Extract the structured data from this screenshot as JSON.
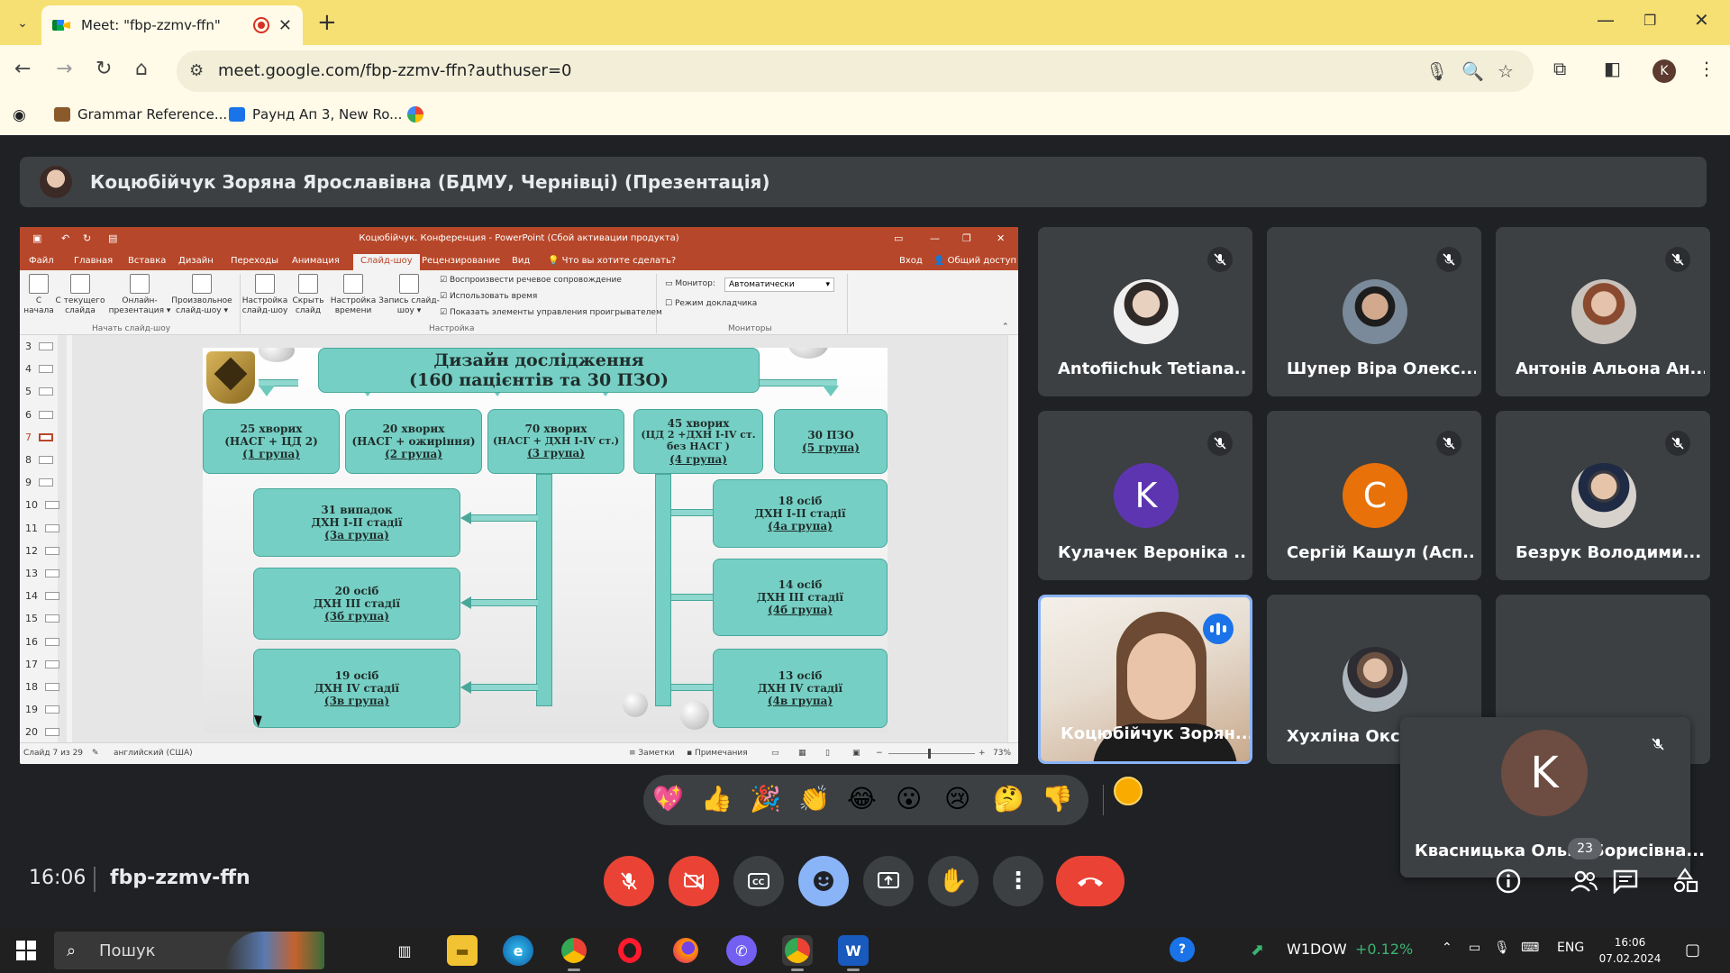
{
  "browser": {
    "tab_title": "Meet: \"fbp-zzmv-ffn\"",
    "new_tab": "+",
    "url": "meet.google.com/fbp-zzmv-ffn?authuser=0",
    "profile_initial": "K",
    "bookmarks": [
      {
        "label": "Grammar Reference...",
        "color": "#8b5a2b"
      },
      {
        "label": "Раунд Ап 3, New Ro...",
        "color": "#1a73e8"
      }
    ]
  },
  "meet": {
    "presenter_title": "Коцюбійчук Зоряна Ярославівна (БДМУ, Чернівці) (Презентація)",
    "time": "16:06",
    "meeting_code": "fbp-zzmv-ffn",
    "participants_count": "23",
    "participants": [
      {
        "name": "Antofiichuk Tetiana...",
        "type": "photo",
        "color": "#d9d2c8"
      },
      {
        "name": "Шупер Віра Олекс...",
        "type": "photo",
        "color": "#7a8a9a"
      },
      {
        "name": "Антонів Альона Ан...",
        "type": "photo",
        "color": "#b89a88"
      },
      {
        "name": "Кулачек Вероніка ...",
        "type": "letter",
        "letter": "K",
        "color": "#5e35b1"
      },
      {
        "name": "Сергій Кашул (Асп...",
        "type": "letter",
        "letter": "C",
        "color": "#e8710a"
      },
      {
        "name": "Безрук Володими...",
        "type": "photo",
        "color": "#c9c2bc"
      },
      {
        "name": "Коцюбійчук Зорян...",
        "type": "video"
      },
      {
        "name": "Хухліна Окса...",
        "type": "photo",
        "color": "#9aa4ad"
      }
    ],
    "floating_participant": {
      "name": "Квасницька Ольга Борисівна...",
      "letter": "K",
      "color": "#6d4c41"
    },
    "reactions": [
      "💖",
      "👍",
      "🎉",
      "👏",
      "😂",
      "😮",
      "😢",
      "🤔",
      "👎"
    ]
  },
  "powerpoint": {
    "window_title": "Коцюбійчук. Конференция - PowerPoint (Сбой активации продукта)",
    "menu": [
      "Файл",
      "Главная",
      "Вставка",
      "Дизайн",
      "Переходы",
      "Анимация",
      "Слайд-шоу",
      "Рецензирование",
      "Вид"
    ],
    "active_menu_index": 6,
    "tell_me": "Что вы хотите сделать?",
    "signin": "Вход",
    "share": "Общий доступ",
    "ribbon": {
      "btn_from_start": "С\nначала",
      "btn_from_current": "С текущего\nслайда",
      "btn_online": "Онлайн-\nпрезентация ▾",
      "btn_custom": "Произвольное\nслайд-шоу ▾",
      "btn_setup": "Настройка\nслайд-шоу",
      "btn_hide": "Скрыть\nслайд",
      "btn_rehearse": "Настройка\nвремени",
      "btn_record": "Запись слайд-\nшоу ▾",
      "check_narration": "Воспроизвести речевое сопровождение",
      "check_timings": "Использовать время",
      "check_controls": "Показать элементы управления проигрывателем",
      "monitor_label": "Монитор:",
      "monitor_value": "Автоматически",
      "presenter_view": "Режим докладчика",
      "group_start": "Начать слайд-шоу",
      "group_setup": "Настройка",
      "group_monitors": "Мониторы"
    },
    "thumb_numbers": [
      "3",
      "4",
      "5",
      "6",
      "7",
      "8",
      "9",
      "10",
      "11",
      "12",
      "13",
      "14",
      "15",
      "16",
      "17",
      "18",
      "19",
      "20"
    ],
    "current_slide_number": "7",
    "status_slide": "Слайд 7 из 29",
    "status_lang": "английский (США)",
    "status_notes": "Заметки",
    "status_comments": "Примечания",
    "zoom": "73%"
  },
  "slide": {
    "title_line1": "Дизайн дослідження",
    "title_line2": "(160 пацієнтів та 30 ПЗО)",
    "groups": [
      {
        "l1": "25 хворих",
        "l2": "(НАСГ + ЦД 2)",
        "l3": "(1 група)"
      },
      {
        "l1": "20 хворих",
        "l2": "(НАСГ + ожиріння)",
        "l3": "(2 група)"
      },
      {
        "l1": "70 хворих",
        "l2": "(НАСГ + ДХН І-ІV ст.)",
        "l3": "(3 група)"
      },
      {
        "l1": "45 хворих",
        "l2": "(ЦД 2 +ДХН І-ІV ст.",
        "l2b": "без НАСГ )",
        "l3": "(4 група)"
      },
      {
        "l1": "30 ПЗО",
        "l2": "",
        "l3": "(5 група)"
      }
    ],
    "left_sub": [
      {
        "l1": "31 випадок",
        "l2": "ДХН І-ІІ стадії",
        "l3": "(3а група)"
      },
      {
        "l1": "20 осіб",
        "l2": "ДХН ІІІ стадії",
        "l3": "(3б група)"
      },
      {
        "l1": "19 осіб",
        "l2": "ДХН ІV стадії",
        "l3": "(3в група)"
      }
    ],
    "right_sub": [
      {
        "l1": "18 осіб",
        "l2": "ДХН І-ІІ стадії",
        "l3": "(4а група)"
      },
      {
        "l1": "14 осіб",
        "l2": "ДХН ІІІ стадії",
        "l3": "(4б група)"
      },
      {
        "l1": "13 осіб",
        "l2": "ДХН ІV стадії",
        "l3": "(4в група)"
      }
    ]
  },
  "taskbar": {
    "search_placeholder": "Пошук",
    "stock_name": "W1DOW",
    "stock_change": "+0.12%",
    "lang": "ENG",
    "clock_time": "16:06",
    "clock_date": "07.02.2024"
  },
  "colors": {
    "tab_strip": "#f7e073",
    "meet_bg": "#202124",
    "ppt_red": "#b7472a",
    "slide_box": "#76cfc4",
    "end_call": "#ea4335",
    "accent_blue": "#8ab4f8",
    "stock_up": "#3cb371"
  }
}
